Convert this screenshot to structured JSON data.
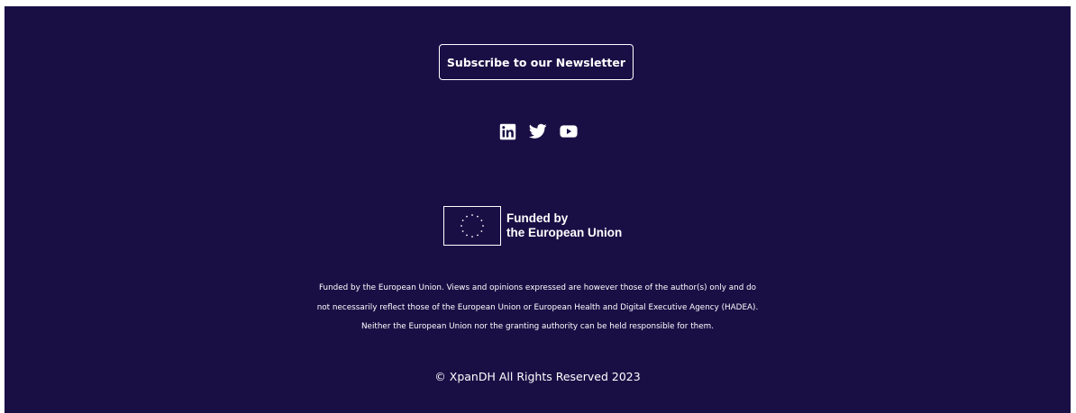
{
  "footer": {
    "subscribe_label": "Subscribe to our Newsletter",
    "social_icons": [
      "linkedin-icon",
      "twitter-icon",
      "youtube-icon"
    ],
    "eu_logo": {
      "line1": "Funded by",
      "line2": "the European Union"
    },
    "disclaimer": [
      "Funded by the European Union. Views and opinions expressed are however those of the author(s) only and do",
      "not necessarily reflect those of the European Union or European Health and Digital Executive Agency (HADEA).",
      "Neither the European Union nor the granting authority can be held responsible for them."
    ],
    "copyright": "© XpanDH All Rights Reserved 2023"
  },
  "colors": {
    "background": "#1a0f45",
    "foreground": "#ffffff"
  }
}
